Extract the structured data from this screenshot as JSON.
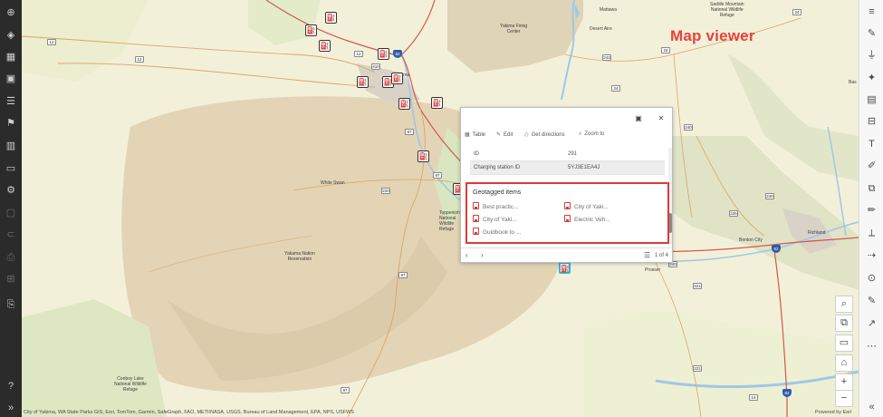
{
  "annotation": {
    "title": "Map viewer"
  },
  "left_toolbar": {
    "items": [
      {
        "name": "add-icon",
        "glyph": "⊕",
        "active": true
      },
      {
        "name": "layers-icon",
        "glyph": "◈",
        "active": true
      },
      {
        "name": "tables-icon",
        "glyph": "▦",
        "active": true
      },
      {
        "name": "basemap-icon",
        "glyph": "▣",
        "active": true
      },
      {
        "name": "legend-icon",
        "glyph": "☰",
        "active": true
      },
      {
        "name": "bookmarks-icon",
        "glyph": "⚑",
        "active": true
      },
      {
        "name": "charts-icon",
        "glyph": "▥",
        "active": true
      },
      {
        "name": "map-tools-icon",
        "glyph": "▭",
        "active": true
      },
      {
        "name": "settings-icon",
        "glyph": "⚙",
        "active": true
      },
      {
        "name": "save-icon",
        "glyph": "▢",
        "active": false
      },
      {
        "name": "share-icon",
        "glyph": "⊂",
        "active": false
      },
      {
        "name": "print-icon",
        "glyph": "⎙",
        "active": false
      },
      {
        "name": "embed-icon",
        "glyph": "⊞",
        "active": false
      },
      {
        "name": "print-map-icon",
        "glyph": "⎘",
        "active": true
      },
      {
        "name": "help-icon",
        "glyph": "?",
        "active": true
      },
      {
        "name": "expand-icon",
        "glyph": "»",
        "active": true
      }
    ]
  },
  "right_toolbar": {
    "items": [
      {
        "name": "properties-icon",
        "glyph": "≡"
      },
      {
        "name": "styles-icon",
        "glyph": "✎"
      },
      {
        "name": "filter-icon",
        "glyph": "⏚"
      },
      {
        "name": "effects-icon",
        "glyph": "✦"
      },
      {
        "name": "pop-ups-icon",
        "glyph": "▤"
      },
      {
        "name": "fields-icon",
        "glyph": "⊟"
      },
      {
        "name": "labels-icon",
        "glyph": "T"
      },
      {
        "name": "forms-icon",
        "glyph": "✐"
      },
      {
        "name": "analysis-icon",
        "glyph": "⧉"
      },
      {
        "name": "sketch-icon",
        "glyph": "✏"
      },
      {
        "name": "measure-icon",
        "glyph": "⟂"
      },
      {
        "name": "directions-icon",
        "glyph": "⇢"
      },
      {
        "name": "locate-icon",
        "glyph": "⊙"
      },
      {
        "name": "edit-icon",
        "glyph": "✎"
      },
      {
        "name": "draw-icon",
        "glyph": "↗"
      },
      {
        "name": "more-icon",
        "glyph": "⋯"
      },
      {
        "name": "collapse-icon",
        "glyph": "«"
      }
    ]
  },
  "map_controls": [
    {
      "name": "search-icon",
      "glyph": "⌕"
    },
    {
      "name": "layer-list-icon",
      "glyph": "⧉"
    },
    {
      "name": "screen-icon",
      "glyph": "▭"
    },
    {
      "name": "home-icon",
      "glyph": "⌂"
    },
    {
      "name": "zoom-in-icon",
      "glyph": "+"
    },
    {
      "name": "zoom-out-icon",
      "glyph": "−"
    }
  ],
  "places": {
    "yakima_firing_center": "Yakima Firing\nCenter",
    "white_swan": "White Swan",
    "yakama_reservation": "Yakama Nation\nReservation",
    "toppenish_refuge": "Toppenish\nNational\nWildlife\nRefuge",
    "conboy_lake": "Conboy Lake\nNational Wildlife\nRefuge",
    "benton_city": "Benton City",
    "richland": "Richland",
    "desert_aire": "Desert Aire",
    "mattawa": "Mattawa",
    "saddle_mountain": "Saddle Mountain\nNational Wildlife\nRefuge",
    "yakima_short": "ima",
    "prosser": "Prosser",
    "bas": "Bas"
  },
  "roads": [
    "12",
    "12",
    "12",
    "410",
    "24",
    "24",
    "243",
    "240",
    "240",
    "225",
    "240",
    "221",
    "221",
    "97",
    "97",
    "97",
    "97",
    "220",
    "24",
    "14",
    "82",
    "82",
    "82",
    "82"
  ],
  "popup": {
    "toolbar": {
      "table": "Table",
      "edit": "Edit",
      "directions": "Get directions",
      "zoom": "Zoom to"
    },
    "fields": [
      {
        "label": "ID",
        "value": "291"
      },
      {
        "label": "Charging station ID",
        "value": "5YJ3E1EA4J"
      }
    ],
    "geotagged": {
      "title": "Geotagged items",
      "items": [
        "Best practic...",
        "City of Yaki...",
        "City of Yaki...",
        "Electric Veh...",
        "Guidbook to ..."
      ]
    },
    "paging": "1 of 4"
  },
  "footer": {
    "attribution": "City of Yakima, WA State Parks GIS, Esri, TomTom, Garmin, SafeGraph, FAO, METI/NASA, USGS, Bureau of Land Management, EPA, NPS, USFWS",
    "powered_by": "Powered by Esri"
  }
}
